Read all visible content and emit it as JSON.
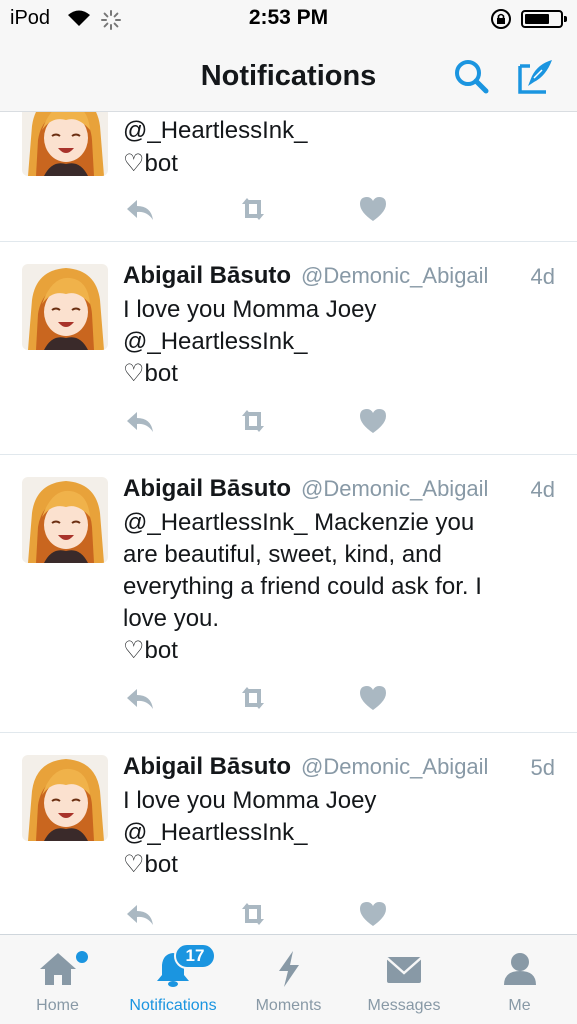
{
  "status_bar": {
    "carrier": "iPod",
    "time": "2:53 PM"
  },
  "header": {
    "title": "Notifications",
    "search_icon": "search-icon",
    "compose_icon": "compose-tweet-icon",
    "accent_color": "#1b95e0"
  },
  "tweets": [
    {
      "name": "",
      "handle": "",
      "time": "",
      "lines": [
        "@_HeartlessInk_",
        "♡bot"
      ]
    },
    {
      "name": "Abigail Bāsuto",
      "handle": "@Demonic_Abigail",
      "time": "4d",
      "lines": [
        "I love you Momma Joey",
        "@_HeartlessInk_",
        "♡bot"
      ]
    },
    {
      "name": "Abigail Bāsuto",
      "handle": "@Demonic_Abigail",
      "time": "4d",
      "lines": [
        "@_HeartlessInk_ Mackenzie you",
        "are beautiful, sweet, kind, and",
        "everything a friend could ask for. I",
        "love you.",
        "♡bot"
      ]
    },
    {
      "name": "Abigail Bāsuto",
      "handle": "@Demonic_Abigail",
      "time": "5d",
      "lines": [
        "I love you Momma Joey",
        "@_HeartlessInk_",
        "♡bot"
      ]
    }
  ],
  "tab_bar": {
    "tabs": [
      {
        "label": "Home",
        "icon": "home-icon"
      },
      {
        "label": "Notifications",
        "icon": "bell-icon",
        "badge": "17"
      },
      {
        "label": "Moments",
        "icon": "lightning-icon"
      },
      {
        "label": "Messages",
        "icon": "envelope-icon"
      },
      {
        "label": "Me",
        "icon": "person-icon"
      }
    ]
  }
}
